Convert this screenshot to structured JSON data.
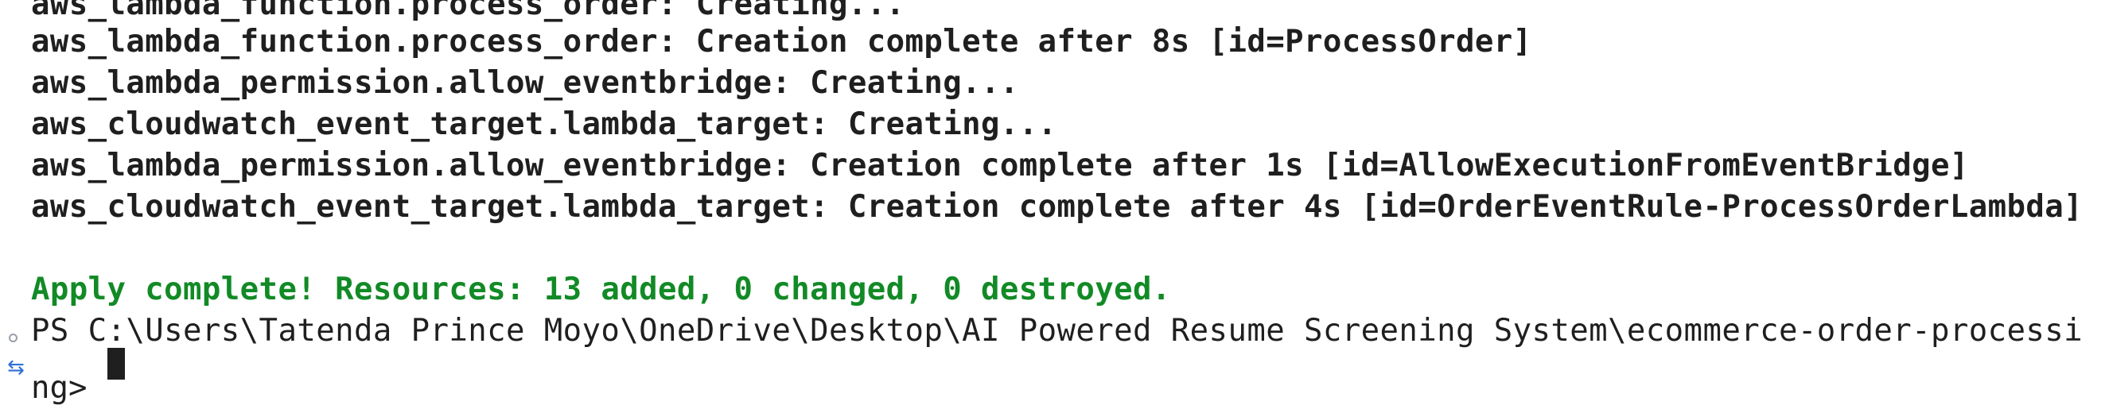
{
  "terminal": {
    "lines": [
      "aws_lambda_function.process_order: Creating...",
      "aws_lambda_function.process_order: Creation complete after 8s [id=ProcessOrder]",
      "aws_lambda_permission.allow_eventbridge: Creating...",
      "aws_cloudwatch_event_target.lambda_target: Creating...",
      "aws_lambda_permission.allow_eventbridge: Creation complete after 1s [id=AllowExecutionFromEventBridge]",
      "aws_cloudwatch_event_target.lambda_target: Creation complete after 4s [id=OrderEventRule-ProcessOrderLambda]"
    ],
    "apply_summary": "Apply complete! Resources: 13 added, 0 changed, 0 destroyed.",
    "prompt_path": "PS C:\\Users\\Tatenda Prince Moyo\\OneDrive\\Desktop\\AI Powered Resume Screening System\\ecommerce-order-processi",
    "prompt_continuation": "ng>",
    "colors": {
      "background": "#ffffff",
      "text": "#1f1f1f",
      "success": "#128a26",
      "gutter_dot": "#9aa0a6",
      "gutter_arrow": "#2f6fd8"
    },
    "icons": {
      "gutter_dot": "circle-outline-icon",
      "gutter_arrow": "arrow-icon"
    }
  }
}
